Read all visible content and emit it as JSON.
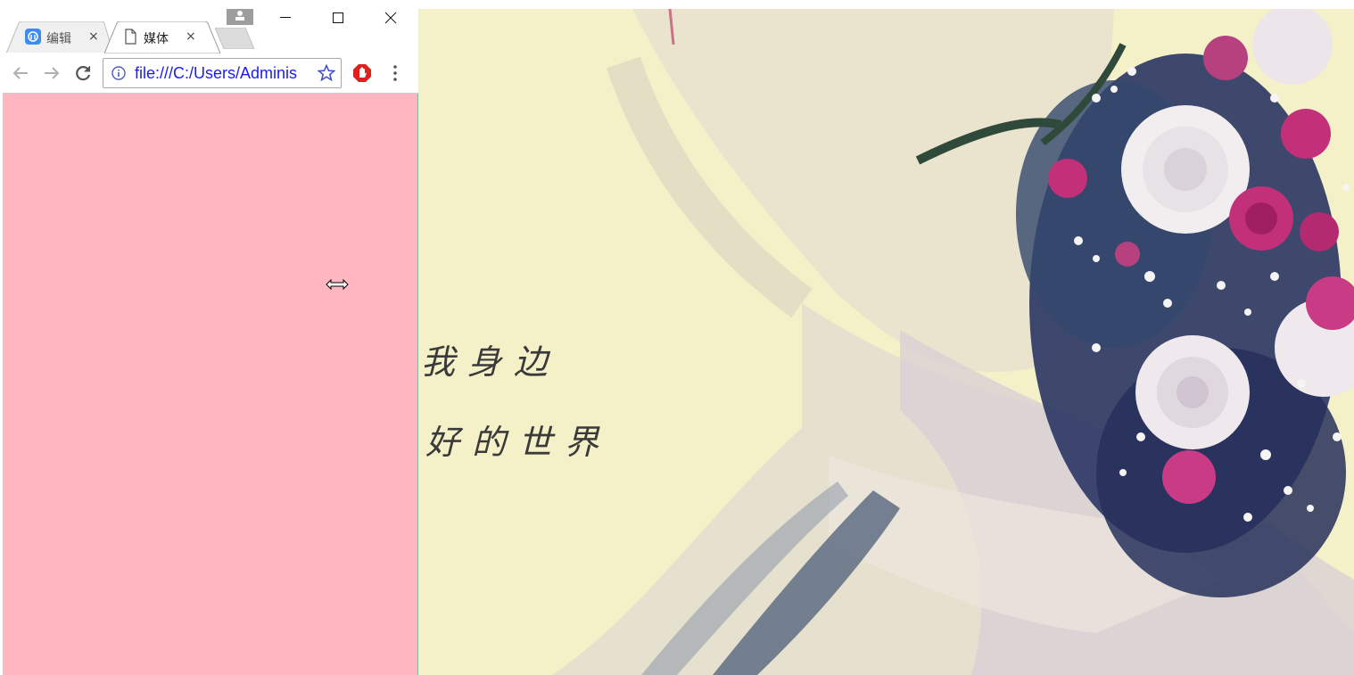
{
  "tabs": [
    {
      "title": "编辑",
      "close": "×",
      "icon": "baidu-icon",
      "active": false
    },
    {
      "title": "媒体",
      "close": "×",
      "icon": "page-icon",
      "active": true
    }
  ],
  "toolbar": {
    "url": "file:///C:/Users/Adminis"
  },
  "page": {
    "background": "#ffb6c1"
  },
  "photo": {
    "caption_line1": "我身边",
    "caption_line2": "好的世界"
  },
  "colors": {
    "url_text": "#1a1aff",
    "page_bg": "#ffb6c1",
    "photo_bg": "#f4f1c8",
    "rose_pink": "#c2307a",
    "rose_white": "#f3f0f0",
    "foliage": "#1f2a5a"
  }
}
